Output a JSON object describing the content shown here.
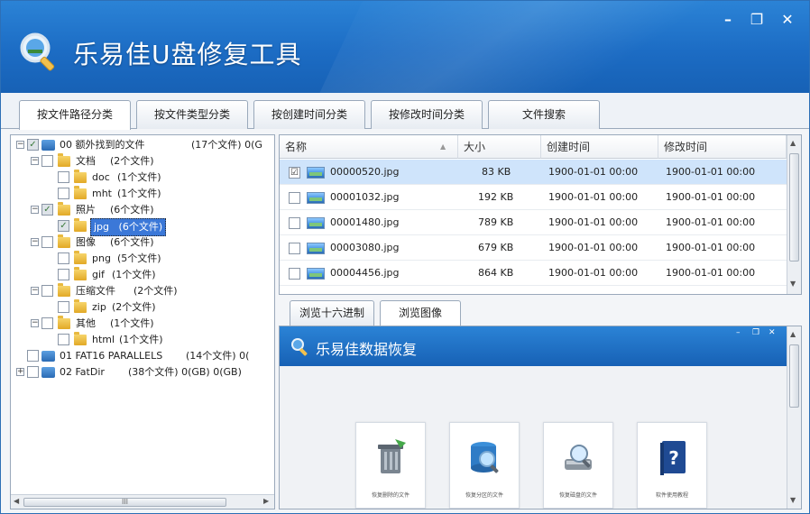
{
  "window": {
    "title": "乐易佳U盘修复工具",
    "minimize": "–",
    "restore": "❐",
    "close": "✕"
  },
  "tabs": [
    {
      "label": "按文件路径分类"
    },
    {
      "label": "按文件类型分类"
    },
    {
      "label": "按创建时间分类"
    },
    {
      "label": "按修改时间分类"
    },
    {
      "label": "文件搜索"
    }
  ],
  "tree": {
    "root0": {
      "label": "00 额外找到的文件",
      "count": "(17个文件) 0(G"
    },
    "doc_folder": {
      "label": "文档",
      "count": "(2个文件)"
    },
    "doc": {
      "label": "doc",
      "count": "(1个文件)"
    },
    "mht": {
      "label": "mht",
      "count": "(1个文件)"
    },
    "photo_folder": {
      "label": "照片",
      "count": "(6个文件)"
    },
    "jpg": {
      "label": "jpg",
      "count": "(6个文件)"
    },
    "image_folder": {
      "label": "图像",
      "count": "(6个文件)"
    },
    "png": {
      "label": "png",
      "count": "(5个文件)"
    },
    "gif": {
      "label": "gif",
      "count": "(1个文件)"
    },
    "zip_folder": {
      "label": "压缩文件",
      "count": "(2个文件)"
    },
    "zip": {
      "label": "zip",
      "count": "(2个文件)"
    },
    "other_folder": {
      "label": "其他",
      "count": "(1个文件)"
    },
    "html": {
      "label": "html",
      "count": "(1个文件)"
    },
    "root1": {
      "label": "01 FAT16 PARALLELS",
      "count": "(14个文件) 0("
    },
    "root2": {
      "label": "02 FatDir",
      "count": "(38个文件) 0(GB) 0(GB)"
    }
  },
  "scroll": {
    "grip": "III"
  },
  "file_list": {
    "columns": {
      "name": "名称",
      "size": "大小",
      "created": "创建时间",
      "modified": "修改时间"
    },
    "rows": [
      {
        "name": "00000520.jpg",
        "size": "83 KB",
        "created": "1900-01-01 00:00",
        "modified": "1900-01-01 00:00",
        "checked": "☑"
      },
      {
        "name": "00001032.jpg",
        "size": "192 KB",
        "created": "1900-01-01 00:00",
        "modified": "1900-01-01 00:00",
        "checked": ""
      },
      {
        "name": "00001480.jpg",
        "size": "789 KB",
        "created": "1900-01-01 00:00",
        "modified": "1900-01-01 00:00",
        "checked": ""
      },
      {
        "name": "00003080.jpg",
        "size": "679 KB",
        "created": "1900-01-01 00:00",
        "modified": "1900-01-01 00:00",
        "checked": ""
      },
      {
        "name": "00004456.jpg",
        "size": "864 KB",
        "created": "1900-01-01 00:00",
        "modified": "1900-01-01 00:00",
        "checked": ""
      }
    ]
  },
  "subtabs": [
    {
      "label": "浏览十六进制"
    },
    {
      "label": "浏览图像"
    }
  ],
  "preview": {
    "title": "乐易佳数据恢复",
    "tiles": [
      {
        "label": "恢复删除的文件"
      },
      {
        "label": "恢复分区的文件"
      },
      {
        "label": "恢复磁盘的文件"
      },
      {
        "label": "软件使用教程"
      }
    ]
  },
  "colors": {
    "titlebar": "#1c6cc4",
    "selection": "#cfe4fb",
    "accent": "#3b78d8"
  }
}
